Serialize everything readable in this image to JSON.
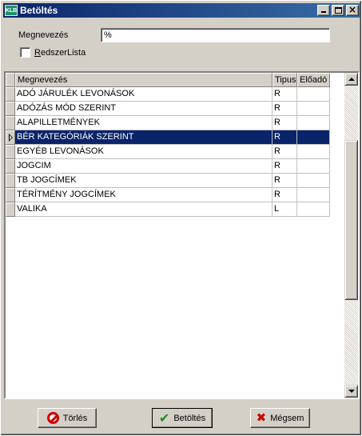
{
  "window": {
    "title": "Betöltés",
    "icon_text": "KLB",
    "minimize_icon": "minimize-icon",
    "maximize_icon": "maximize-icon",
    "close_icon": "close-icon",
    "close_glyph": "×"
  },
  "filter": {
    "name_label": "Megnevezés",
    "name_value": "%",
    "checkbox_label_underlined": "R",
    "checkbox_label_rest": "edszerLista",
    "checkbox_checked": false
  },
  "grid": {
    "columns": [
      "Megnevezés",
      "Tipus",
      "Előadó"
    ],
    "selected_index": 3,
    "selection_color": "#0a246a",
    "rows": [
      {
        "name": "ADÓ JÁRULÉK LEVONÁSOK",
        "tipus": "R",
        "eloado": ""
      },
      {
        "name": "ADÓZÁS MÓD SZERINT",
        "tipus": "R",
        "eloado": ""
      },
      {
        "name": "ALAPILLETMÉNYEK",
        "tipus": "R",
        "eloado": ""
      },
      {
        "name": "BÉR KATEGÓRIÁK SZERINT",
        "tipus": "R",
        "eloado": ""
      },
      {
        "name": "EGYÉB LEVONÁSOK",
        "tipus": "R",
        "eloado": ""
      },
      {
        "name": "JOGCIM",
        "tipus": "R",
        "eloado": ""
      },
      {
        "name": "TB JOGCÍMEK",
        "tipus": "R",
        "eloado": ""
      },
      {
        "name": "TÉRÍTMÉNY JOGCÍMEK",
        "tipus": "R",
        "eloado": ""
      },
      {
        "name": "VALIKA",
        "tipus": "L",
        "eloado": ""
      }
    ]
  },
  "buttons": {
    "delete_label": "Törlés",
    "load_label": "Betöltés",
    "cancel_label": "Mégsem",
    "delete_icon": "delete-icon",
    "load_icon": "checkmark-icon",
    "cancel_icon": "x-icon"
  }
}
